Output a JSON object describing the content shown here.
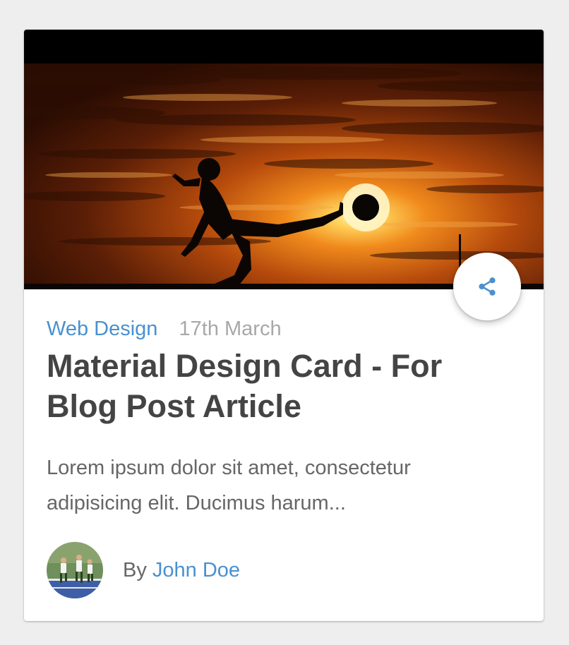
{
  "card": {
    "category": "Web Design",
    "date": "17th March",
    "title": "Material Design Card - For Blog Post Article",
    "excerpt": "Lorem ipsum dolor sit amet, consectetur adipisicing elit. Ducimus harum...",
    "author_prefix": "By",
    "author_name": "John Doe",
    "share_icon": "share-icon",
    "accent_color": "#4a90cf"
  }
}
